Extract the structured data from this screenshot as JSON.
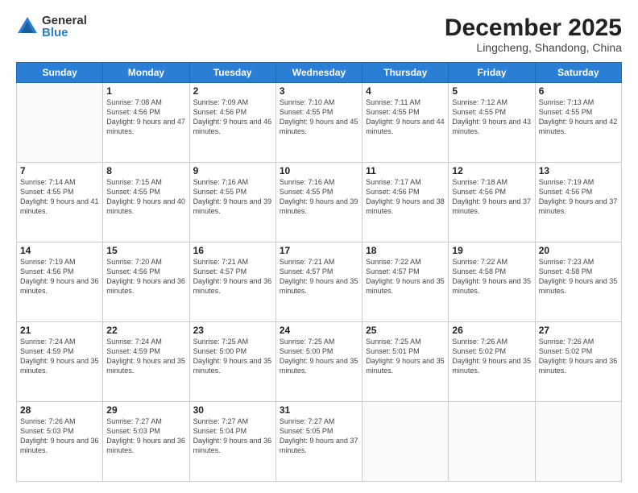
{
  "logo": {
    "general": "General",
    "blue": "Blue"
  },
  "title": "December 2025",
  "location": "Lingcheng, Shandong, China",
  "days_of_week": [
    "Sunday",
    "Monday",
    "Tuesday",
    "Wednesday",
    "Thursday",
    "Friday",
    "Saturday"
  ],
  "weeks": [
    [
      {
        "day": "",
        "sunrise": "",
        "sunset": "",
        "daylight": ""
      },
      {
        "day": "1",
        "sunrise": "Sunrise: 7:08 AM",
        "sunset": "Sunset: 4:56 PM",
        "daylight": "Daylight: 9 hours and 47 minutes."
      },
      {
        "day": "2",
        "sunrise": "Sunrise: 7:09 AM",
        "sunset": "Sunset: 4:56 PM",
        "daylight": "Daylight: 9 hours and 46 minutes."
      },
      {
        "day": "3",
        "sunrise": "Sunrise: 7:10 AM",
        "sunset": "Sunset: 4:55 PM",
        "daylight": "Daylight: 9 hours and 45 minutes."
      },
      {
        "day": "4",
        "sunrise": "Sunrise: 7:11 AM",
        "sunset": "Sunset: 4:55 PM",
        "daylight": "Daylight: 9 hours and 44 minutes."
      },
      {
        "day": "5",
        "sunrise": "Sunrise: 7:12 AM",
        "sunset": "Sunset: 4:55 PM",
        "daylight": "Daylight: 9 hours and 43 minutes."
      },
      {
        "day": "6",
        "sunrise": "Sunrise: 7:13 AM",
        "sunset": "Sunset: 4:55 PM",
        "daylight": "Daylight: 9 hours and 42 minutes."
      }
    ],
    [
      {
        "day": "7",
        "sunrise": "Sunrise: 7:14 AM",
        "sunset": "Sunset: 4:55 PM",
        "daylight": "Daylight: 9 hours and 41 minutes."
      },
      {
        "day": "8",
        "sunrise": "Sunrise: 7:15 AM",
        "sunset": "Sunset: 4:55 PM",
        "daylight": "Daylight: 9 hours and 40 minutes."
      },
      {
        "day": "9",
        "sunrise": "Sunrise: 7:16 AM",
        "sunset": "Sunset: 4:55 PM",
        "daylight": "Daylight: 9 hours and 39 minutes."
      },
      {
        "day": "10",
        "sunrise": "Sunrise: 7:16 AM",
        "sunset": "Sunset: 4:55 PM",
        "daylight": "Daylight: 9 hours and 39 minutes."
      },
      {
        "day": "11",
        "sunrise": "Sunrise: 7:17 AM",
        "sunset": "Sunset: 4:56 PM",
        "daylight": "Daylight: 9 hours and 38 minutes."
      },
      {
        "day": "12",
        "sunrise": "Sunrise: 7:18 AM",
        "sunset": "Sunset: 4:56 PM",
        "daylight": "Daylight: 9 hours and 37 minutes."
      },
      {
        "day": "13",
        "sunrise": "Sunrise: 7:19 AM",
        "sunset": "Sunset: 4:56 PM",
        "daylight": "Daylight: 9 hours and 37 minutes."
      }
    ],
    [
      {
        "day": "14",
        "sunrise": "Sunrise: 7:19 AM",
        "sunset": "Sunset: 4:56 PM",
        "daylight": "Daylight: 9 hours and 36 minutes."
      },
      {
        "day": "15",
        "sunrise": "Sunrise: 7:20 AM",
        "sunset": "Sunset: 4:56 PM",
        "daylight": "Daylight: 9 hours and 36 minutes."
      },
      {
        "day": "16",
        "sunrise": "Sunrise: 7:21 AM",
        "sunset": "Sunset: 4:57 PM",
        "daylight": "Daylight: 9 hours and 36 minutes."
      },
      {
        "day": "17",
        "sunrise": "Sunrise: 7:21 AM",
        "sunset": "Sunset: 4:57 PM",
        "daylight": "Daylight: 9 hours and 35 minutes."
      },
      {
        "day": "18",
        "sunrise": "Sunrise: 7:22 AM",
        "sunset": "Sunset: 4:57 PM",
        "daylight": "Daylight: 9 hours and 35 minutes."
      },
      {
        "day": "19",
        "sunrise": "Sunrise: 7:22 AM",
        "sunset": "Sunset: 4:58 PM",
        "daylight": "Daylight: 9 hours and 35 minutes."
      },
      {
        "day": "20",
        "sunrise": "Sunrise: 7:23 AM",
        "sunset": "Sunset: 4:58 PM",
        "daylight": "Daylight: 9 hours and 35 minutes."
      }
    ],
    [
      {
        "day": "21",
        "sunrise": "Sunrise: 7:24 AM",
        "sunset": "Sunset: 4:59 PM",
        "daylight": "Daylight: 9 hours and 35 minutes."
      },
      {
        "day": "22",
        "sunrise": "Sunrise: 7:24 AM",
        "sunset": "Sunset: 4:59 PM",
        "daylight": "Daylight: 9 hours and 35 minutes."
      },
      {
        "day": "23",
        "sunrise": "Sunrise: 7:25 AM",
        "sunset": "Sunset: 5:00 PM",
        "daylight": "Daylight: 9 hours and 35 minutes."
      },
      {
        "day": "24",
        "sunrise": "Sunrise: 7:25 AM",
        "sunset": "Sunset: 5:00 PM",
        "daylight": "Daylight: 9 hours and 35 minutes."
      },
      {
        "day": "25",
        "sunrise": "Sunrise: 7:25 AM",
        "sunset": "Sunset: 5:01 PM",
        "daylight": "Daylight: 9 hours and 35 minutes."
      },
      {
        "day": "26",
        "sunrise": "Sunrise: 7:26 AM",
        "sunset": "Sunset: 5:02 PM",
        "daylight": "Daylight: 9 hours and 35 minutes."
      },
      {
        "day": "27",
        "sunrise": "Sunrise: 7:26 AM",
        "sunset": "Sunset: 5:02 PM",
        "daylight": "Daylight: 9 hours and 36 minutes."
      }
    ],
    [
      {
        "day": "28",
        "sunrise": "Sunrise: 7:26 AM",
        "sunset": "Sunset: 5:03 PM",
        "daylight": "Daylight: 9 hours and 36 minutes."
      },
      {
        "day": "29",
        "sunrise": "Sunrise: 7:27 AM",
        "sunset": "Sunset: 5:03 PM",
        "daylight": "Daylight: 9 hours and 36 minutes."
      },
      {
        "day": "30",
        "sunrise": "Sunrise: 7:27 AM",
        "sunset": "Sunset: 5:04 PM",
        "daylight": "Daylight: 9 hours and 36 minutes."
      },
      {
        "day": "31",
        "sunrise": "Sunrise: 7:27 AM",
        "sunset": "Sunset: 5:05 PM",
        "daylight": "Daylight: 9 hours and 37 minutes."
      },
      {
        "day": "",
        "sunrise": "",
        "sunset": "",
        "daylight": ""
      },
      {
        "day": "",
        "sunrise": "",
        "sunset": "",
        "daylight": ""
      },
      {
        "day": "",
        "sunrise": "",
        "sunset": "",
        "daylight": ""
      }
    ]
  ]
}
